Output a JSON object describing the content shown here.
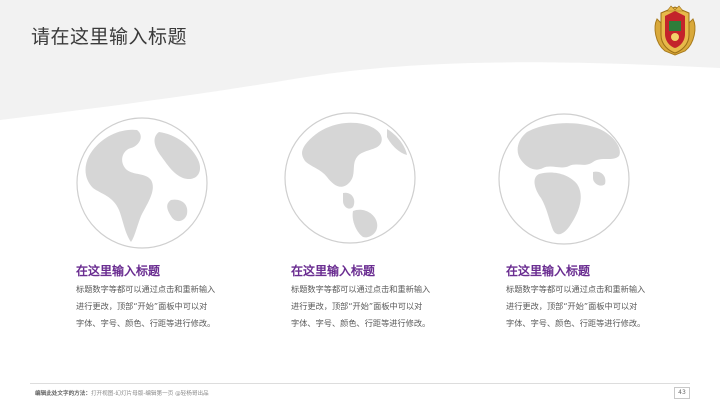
{
  "slide": {
    "title": "请在这里输入标题",
    "emblem_icon": "school-crest-icon",
    "accent_color": "#6a2d91"
  },
  "cards": [
    {
      "title": "在这里输入标题",
      "lines": [
        "标题数字等都可以通过点击和重新输入",
        "进行更改，顶部“开始”面板中可以对",
        "字体、字号、颜色、行距等进行修改。"
      ],
      "globe_icon": "globe-americas-icon"
    },
    {
      "title": "在这里输入标题",
      "lines": [
        "标题数字等都可以通过点击和重新输入",
        "进行更改，顶部“开始”面板中可以对",
        "字体、字号、颜色、行距等进行修改。"
      ],
      "globe_icon": "globe-north-america-icon"
    },
    {
      "title": "在这里输入标题",
      "lines": [
        "标题数字等都可以通过点击和重新输入",
        "进行更改，顶部“开始”面板中可以对",
        "字体、字号、颜色、行距等进行修改。"
      ],
      "globe_icon": "globe-europe-africa-icon"
    }
  ],
  "footer": {
    "label": "编辑此处文字的方法：",
    "text": "打开视图-幻灯片母版-编辑第一页 @轻杨哥出品",
    "page_number": "43"
  }
}
